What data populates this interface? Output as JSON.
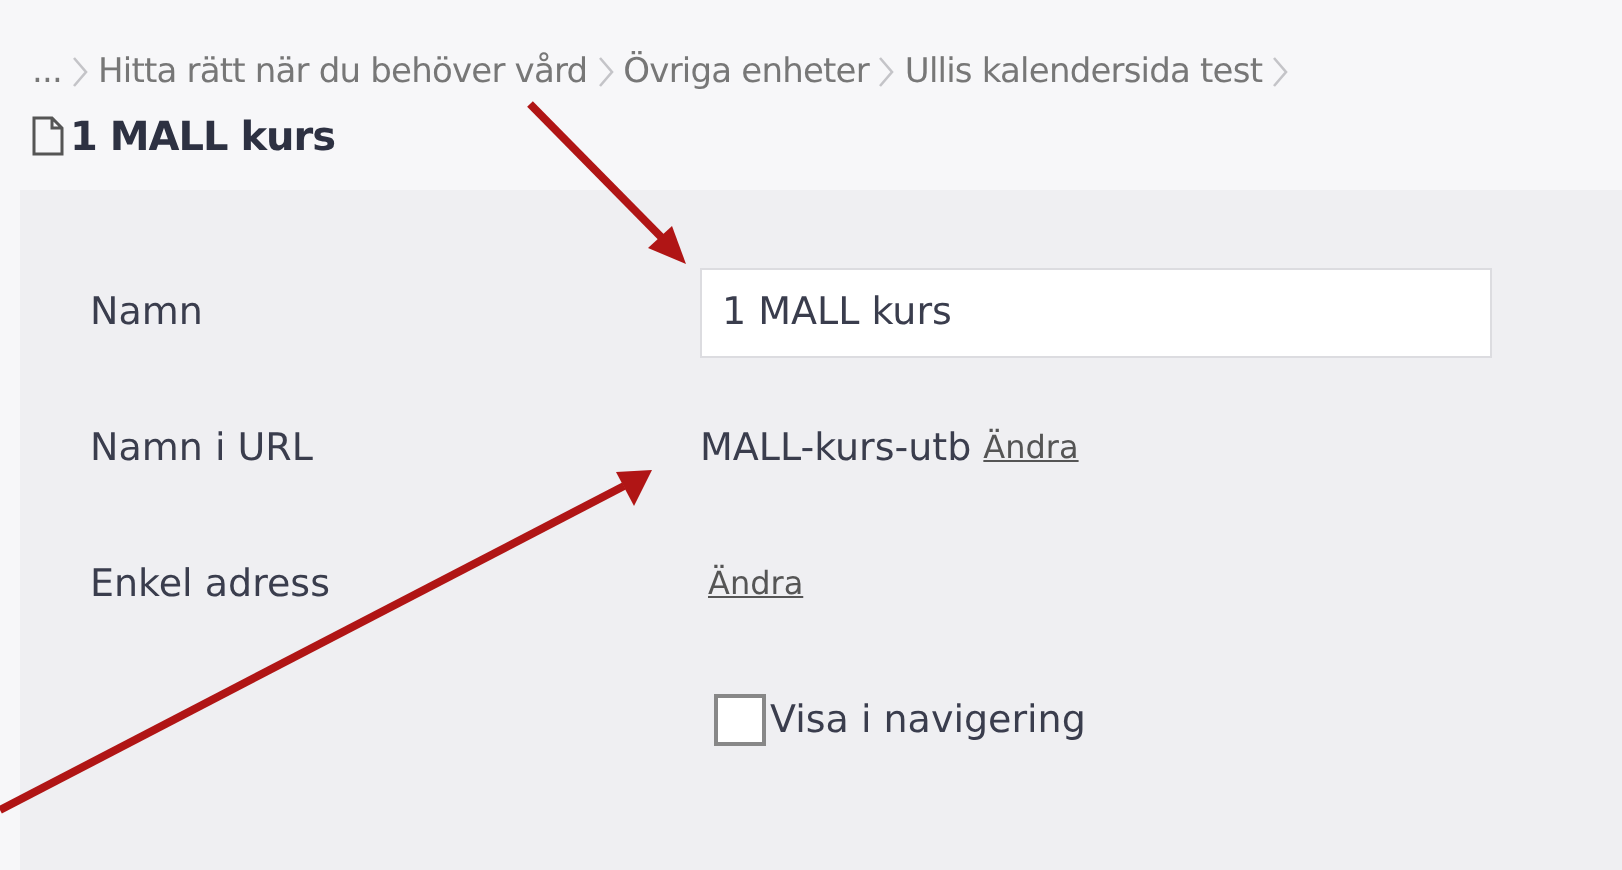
{
  "breadcrumb": {
    "ellipsis": "...",
    "items": [
      "Hitta rätt när du behöver vård",
      "Övriga enheter",
      "Ullis kalendersida test"
    ]
  },
  "page_title": "1 MALL kurs",
  "form": {
    "rows": [
      {
        "kind": "input",
        "label": "Namn",
        "value": "1 MALL kurs"
      },
      {
        "kind": "text_link",
        "label": "Namn i URL",
        "value": "MALL-kurs-utb",
        "link": "Ändra"
      },
      {
        "kind": "link",
        "label": "Enkel adress",
        "link": "Ändra"
      },
      {
        "kind": "checkbox",
        "label": "Visa i navigering",
        "checked": false
      }
    ]
  }
}
